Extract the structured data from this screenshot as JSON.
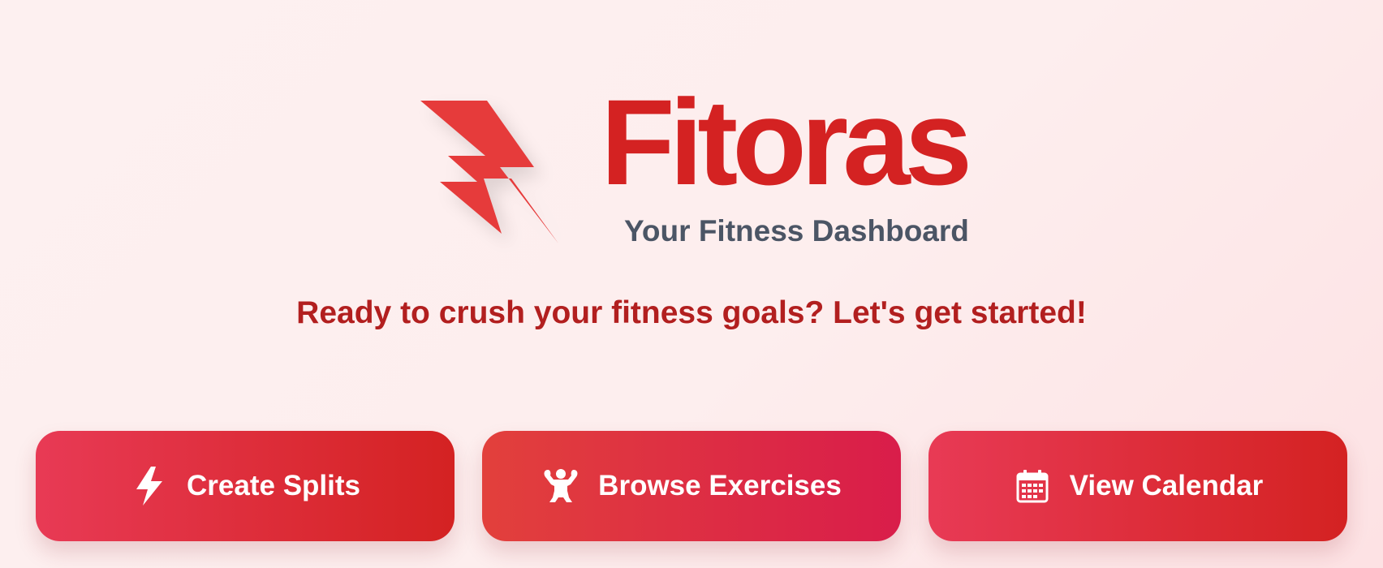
{
  "brand": {
    "name": "Fitoras",
    "subtitle": "Your Fitness Dashboard",
    "logo_icon": "lightning-bolt-icon",
    "accent_color": "#d42222",
    "logo_color": "#e63b3b"
  },
  "hero": {
    "tagline": "Ready to crush your fitness goals? Let's get started!"
  },
  "actions": [
    {
      "label": "Create Splits",
      "icon": "lightning-bolt-icon"
    },
    {
      "label": "Browse Exercises",
      "icon": "muscle-man-icon"
    },
    {
      "label": "View Calendar",
      "icon": "calendar-icon"
    }
  ],
  "colors": {
    "button_gradient_start": "#e83a55",
    "button_gradient_end": "#d42222",
    "tagline": "#b21f1f",
    "subtitle": "#4b5565"
  }
}
